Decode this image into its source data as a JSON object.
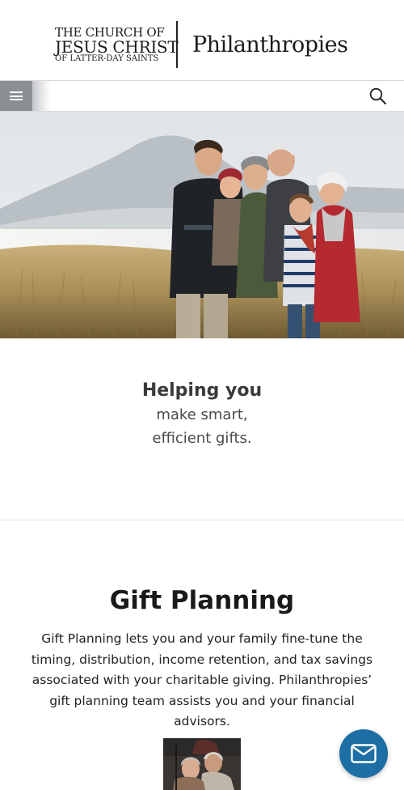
{
  "header": {
    "church_logo": {
      "line1": "THE CHURCH OF",
      "line2": "JESUS CHRIST",
      "line3": "OF LATTER-DAY SAINTS"
    },
    "site_name": "Philanthropies"
  },
  "nav": {
    "menu_icon": "hamburger-menu-icon",
    "search_icon": "magnifying-glass-icon"
  },
  "hero": {
    "image": "family-on-beach-photo"
  },
  "tagline": {
    "heading": "Helping you",
    "line1": "make smart,",
    "line2": "efficient gifts."
  },
  "gift_planning": {
    "title": "Gift Planning",
    "body": "Gift Planning lets you and your family fine-tune the timing, distribution, income retention, and tax savings associated with your charitable giving. Philanthropies’ gift planning team assists you and your financial advisors.",
    "thumbnail": "couple-photo"
  },
  "chat": {
    "icon": "envelope-icon"
  },
  "colors": {
    "menu_button": "#8a8f94",
    "chat_button": "#1c6ea4",
    "heading_text": "#1a1a1a",
    "tagline_text": "#3a3a3a"
  }
}
